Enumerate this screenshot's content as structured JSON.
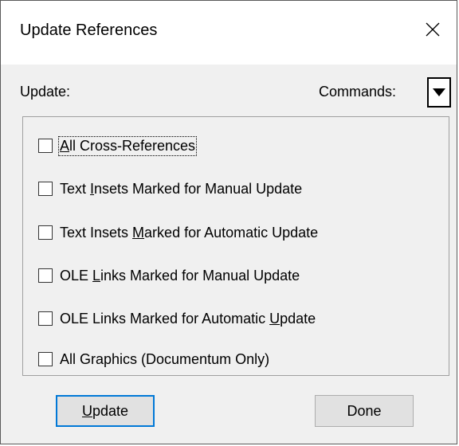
{
  "window": {
    "title": "Update References"
  },
  "header": {
    "update_label": "Update:",
    "commands_label": "Commands:"
  },
  "options": [
    {
      "before": "",
      "accel": "A",
      "after": "ll Cross-References",
      "checked": false
    },
    {
      "before": "Text ",
      "accel": "I",
      "after": "nsets Marked for Manual Update",
      "checked": false
    },
    {
      "before": "Text Insets ",
      "accel": "M",
      "after": "arked for Automatic Update",
      "checked": false
    },
    {
      "before": "OLE ",
      "accel": "L",
      "after": "inks Marked for Manual Update",
      "checked": false
    },
    {
      "before": "OLE Links Marked for Automatic ",
      "accel": "U",
      "after": "pdate",
      "checked": false
    },
    {
      "before": "All Graphics (Documentum Only)",
      "accel": "",
      "after": "",
      "checked": false
    }
  ],
  "buttons": {
    "update": {
      "before": "",
      "accel": "U",
      "after": "pdate"
    },
    "done": {
      "label": "Done"
    }
  },
  "colors": {
    "accent": "#0078d7",
    "dialog_bg": "#f0f0f0",
    "titlebar_bg": "#ffffff"
  },
  "icons": {
    "close": "close-icon",
    "dropdown": "triangle-down-icon"
  }
}
